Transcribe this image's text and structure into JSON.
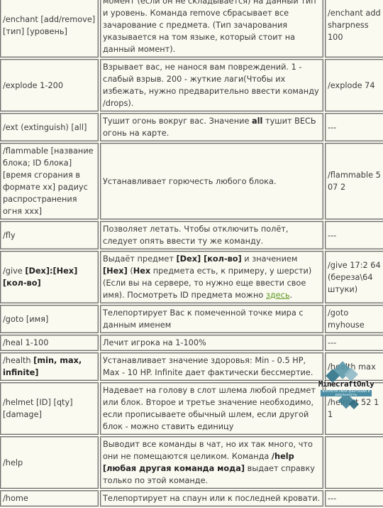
{
  "rows": [
    {
      "command": "/enchant [add/remove] [тип] [уровень]",
      "description": "момент (если он не складывается) на данный тип и уровень. Команда remove сбрасывает все зачарование с предмета. (Тип зачарования указывается на том языке, который стоит на данный момент).",
      "example": "/enchant add sharpness 100"
    },
    {
      "command": "/explode 1-200",
      "description": "Взрывает вас, не нанося вам повреждений. 1 - слабый взрыв. 200 - жуткие лаги(Чтобы их избежать, нужно предварительно ввести команду /drops).",
      "example": "/explode 74"
    },
    {
      "command": "/ext (extinguish) [all]",
      "description_pre": "Тушит огонь вокруг вас. Значение ",
      "description_bold": "all",
      "description_post": " тушит ВЕСЬ огонь на карте.",
      "example": "---"
    },
    {
      "command": "/flammable [название блока; ID блока] [время сгорания в формате xx] радиус распространения огня xxx]",
      "description": "Устанавливает горючесть любого блока.",
      "example": "/flammable 5 07 2"
    },
    {
      "command": "/fly",
      "description": "Позволяет летать. Чтобы отключить полёт, следует опять ввести ту же команду.",
      "example": "---"
    },
    {
      "command_pre": "/give ",
      "command_bold": "[Dex]:[Hex] [кол-во]",
      "description_1": "Выдаёт предмет ",
      "description_2": "[Dex] [кол-во]",
      "description_3": " и значением ",
      "description_4": "[Hex]",
      "description_5": " (",
      "description_6": "Hex",
      "description_7": " предмета есть, к примеру, у шерсти)(Если вы на сервере, то нужно еще ввести свое имя). Посмотреть ID предмета можно ",
      "description_link": "здесь",
      "description_8": ".",
      "example": "/give 17:2 64 (береза\\64 штуки)"
    },
    {
      "command": "/goto [имя]",
      "description": "Телепортирует Вас к помеченной точке мира с данным именем",
      "example": "/goto myhouse"
    },
    {
      "command": "/heal 1-100",
      "description": "Лечит игрока на 1-100%",
      "example": "---"
    },
    {
      "command_pre": "/health ",
      "command_bold": "[min, max, infinite]",
      "description": "Устанавливает значение здоровья: Min - 0.5 HP, Max - 10 HP. Infinite дает фактически бессмертие.",
      "example": "/health max"
    },
    {
      "command": "/helmet [ID] [qty] [damage]",
      "description": "Надевает на голову в слот шлема любой предмет или блок. Второе и третье значение необходимо, если прописываете обычный шлем, если другой блок - можно ставить единицу",
      "example": "/helmet 52 1 1"
    },
    {
      "command": "/help",
      "description_pre": "Выводит все команды в чат, но их так много, что они не помещаются целиком. Команда ",
      "description_bold": "/help [любая другая команда мода]",
      "description_post": " выдает справку только по этой команде.",
      "example": ""
    },
    {
      "command": "/home",
      "description": "Телепортирует на спаун или к последней кровати.",
      "example": "---"
    }
  ],
  "watermark": {
    "title": "MinecraftOnly",
    "subtitle": "воплоти свои фантазии в реальность"
  },
  "colors": {
    "background": "#fbfaf1",
    "border": "#6d6d6d",
    "link": "#5f9a20",
    "text": "#3a3a3a"
  }
}
